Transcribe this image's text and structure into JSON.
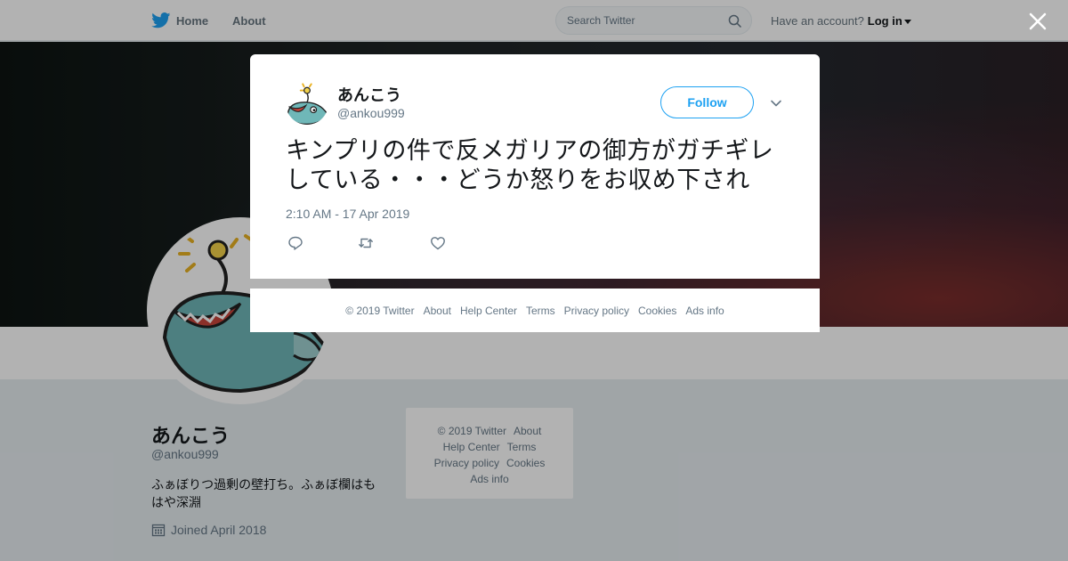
{
  "nav": {
    "home_label": "Home",
    "about_label": "About",
    "search_placeholder": "Search Twitter",
    "account_prompt": "Have an account?",
    "login_label": "Log in"
  },
  "profile": {
    "name": "あんこう",
    "handle": "@ankou999",
    "bio": "ふぁぼりつ過剰の壁打ち。ふぁぼ欄はもはや深淵",
    "joined": "Joined April 2018"
  },
  "side_footer": {
    "copyright": "© 2019 Twitter",
    "about": "About",
    "help": "Help Center",
    "terms": "Terms",
    "privacy": "Privacy policy",
    "cookies": "Cookies",
    "ads": "Ads info"
  },
  "tweet": {
    "author_name": "あんこう",
    "author_handle": "@ankou999",
    "follow_label": "Follow",
    "text": "キンプリの件で反メガリアの御方がガチギレしている・・・どうか怒りをお収め下され",
    "timestamp": "2:10 AM - 17 Apr 2019"
  },
  "modal_footer": {
    "copyright": "© 2019 Twitter",
    "about": "About",
    "help": "Help Center",
    "terms": "Terms",
    "privacy": "Privacy policy",
    "cookies": "Cookies",
    "ads": "Ads info"
  },
  "colors": {
    "brand": "#1da1f2",
    "avatar_fish": "#6fb7b8",
    "overlay": "rgba(0,0,0,0.3)"
  }
}
